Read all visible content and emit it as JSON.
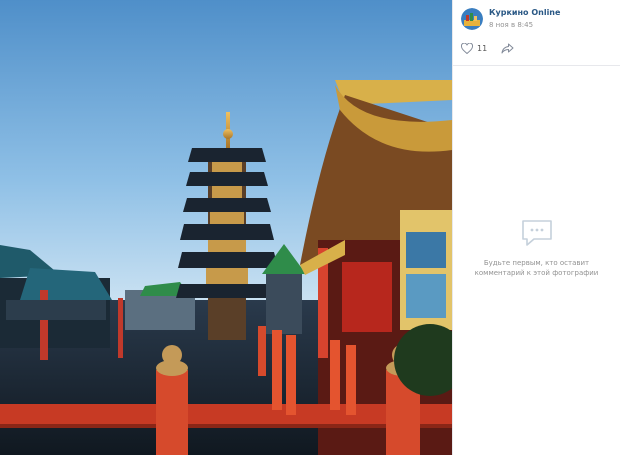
{
  "post": {
    "author_name": "Куркино Online",
    "date": "8 ноя в 8:45",
    "likes_count": "11"
  },
  "comments": {
    "empty_text": "Будьте первым, кто оставит комментарий к этой фотографии"
  },
  "icons": {
    "like": "heart-icon",
    "share": "share-arrow-icon",
    "empty": "speech-bubble-icon"
  },
  "colors": {
    "link": "#2a5885",
    "muted": "#939393",
    "icon": "#828a99",
    "divider": "#e7e8ec"
  }
}
